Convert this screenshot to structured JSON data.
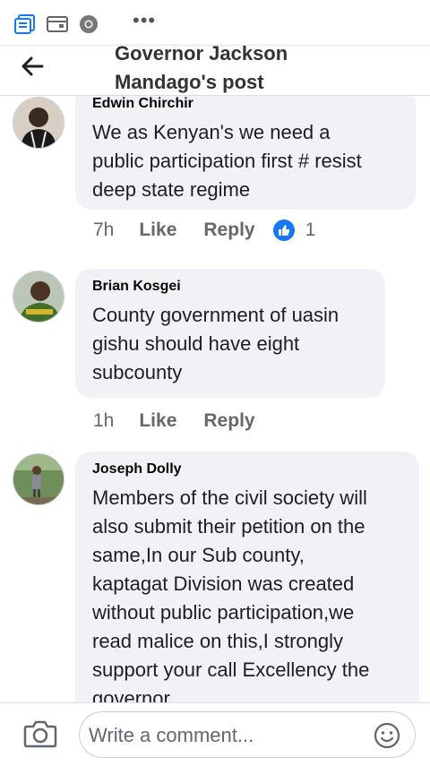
{
  "header": {
    "title_line1": "Governor Jackson",
    "title_line2": "Mandago's post"
  },
  "status_icons": [
    "notes-icon",
    "calendar-icon",
    "chrome-icon",
    "more-icon"
  ],
  "status_dots": "•••",
  "comments": [
    {
      "author": "Edwin Chirchir",
      "text_lines": [
        "We as Kenyan's we need a",
        "public participation first # resist",
        "deep state regime"
      ],
      "time": "7h",
      "like_label": "Like",
      "reply_label": "Reply",
      "reactions": "1"
    },
    {
      "author": "Brian Kosgei",
      "text_lines": [
        "County  government of uasin",
        "gishu should have eight",
        "subcounty"
      ],
      "time": "1h",
      "like_label": "Like",
      "reply_label": "Reply"
    },
    {
      "author": "Joseph Dolly",
      "text_lines": [
        "Members of the civil society will",
        "also submit their petition on the",
        "same,In our Sub county,",
        "kaptagat Division was created",
        "without public participation,we",
        "read malice on this,I strongly",
        "support your call Excellency the",
        "governor."
      ]
    }
  ],
  "composer": {
    "placeholder": "Write a comment..."
  },
  "colors": {
    "accent": "#1877f2",
    "bubble": "#f0f2f5",
    "meta_text": "#65676b"
  }
}
